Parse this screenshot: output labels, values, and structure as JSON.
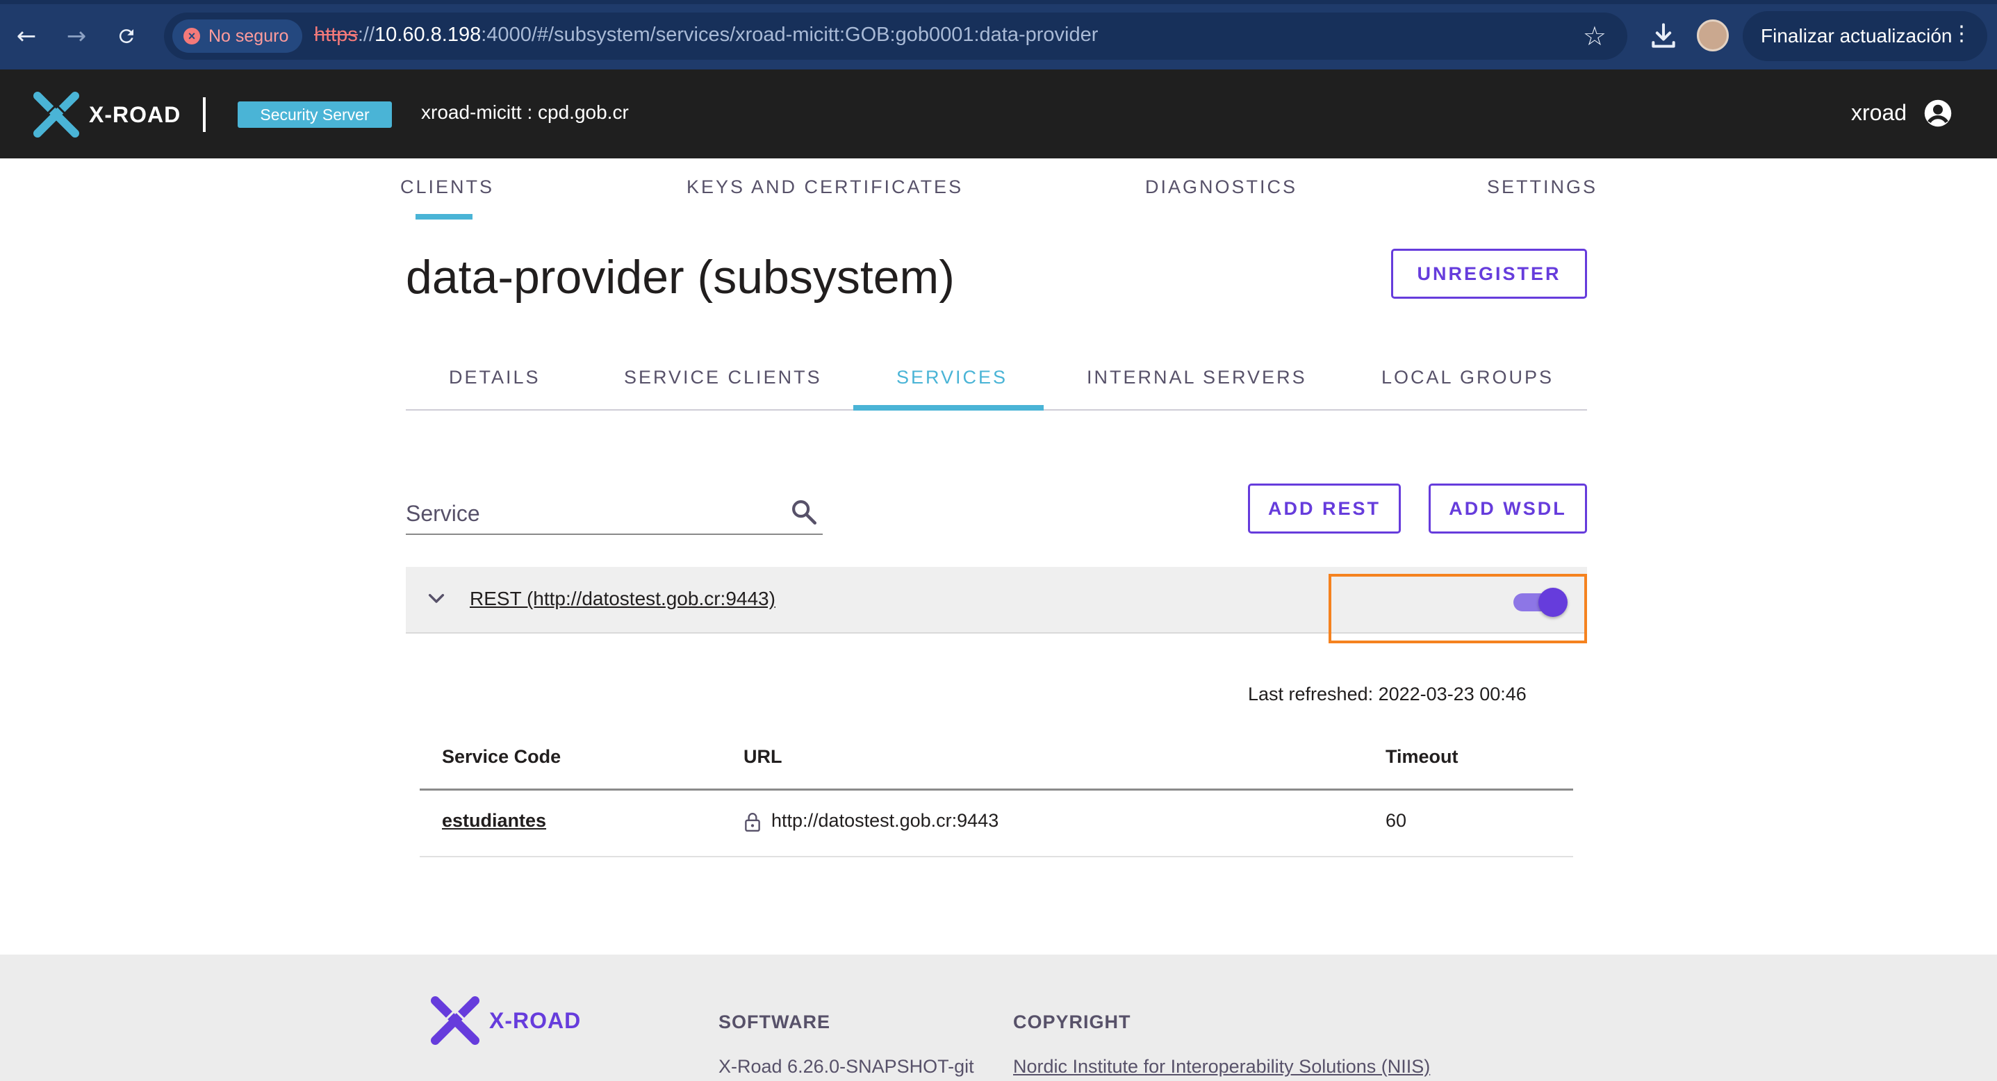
{
  "browser": {
    "security_label": "No seguro",
    "url_protocol": "https",
    "url_host": "10.60.8.198",
    "url_rest": ":4000/#/subsystem/services/xroad-micitt:GOB:gob0001:data-provider",
    "update_button": "Finalizar actualización",
    "icons": [
      "back-arrow-icon",
      "forward-arrow-icon",
      "reload-icon",
      "star-icon",
      "download-icon",
      "kebab-menu-icon"
    ]
  },
  "header": {
    "logo_text": "X-ROAD",
    "badge": "Security Server",
    "server_name": "xroad-micitt : cpd.gob.cr",
    "username": "xroad",
    "bg_color": "#1f1f1f",
    "accent_color": "#4ab4d6"
  },
  "main_nav": {
    "clients": "CLIENTS",
    "keys": "KEYS AND CERTIFICATES",
    "diagnostics": "DIAGNOSTICS",
    "settings": "SETTINGS",
    "active": "CLIENTS"
  },
  "page": {
    "title": "data-provider (subsystem)",
    "unregister_label": "UNREGISTER"
  },
  "subtabs": {
    "details": "DETAILS",
    "service_clients": "SERVICE CLIENTS",
    "services": "SERVICES",
    "internal_servers": "INTERNAL SERVERS",
    "local_groups": "LOCAL GROUPS",
    "active": "SERVICES"
  },
  "toolbar": {
    "search_placeholder": "Service",
    "add_rest": "ADD REST",
    "add_wsdl": "ADD WSDL"
  },
  "service_panel": {
    "label": "REST (http://datostest.gob.cr:9443)",
    "enabled": true,
    "last_refreshed": "Last refreshed: 2022-03-23 00:46"
  },
  "table": {
    "headers": {
      "code": "Service Code",
      "url": "URL",
      "timeout": "Timeout"
    },
    "rows": [
      {
        "code": "estudiantes",
        "url": "http://datostest.gob.cr:9443",
        "timeout": "60"
      }
    ]
  },
  "footer": {
    "logo_text": "X-ROAD",
    "software_heading": "SOFTWARE",
    "software_version": "X-Road 6.26.0-SNAPSHOT-git",
    "copyright_heading": "COPYRIGHT",
    "copyright_link": "Nordic Institute for Interoperability Solutions (NIIS)"
  },
  "colors": {
    "primary": "#663cdc",
    "highlight_box": "#f5821f"
  }
}
